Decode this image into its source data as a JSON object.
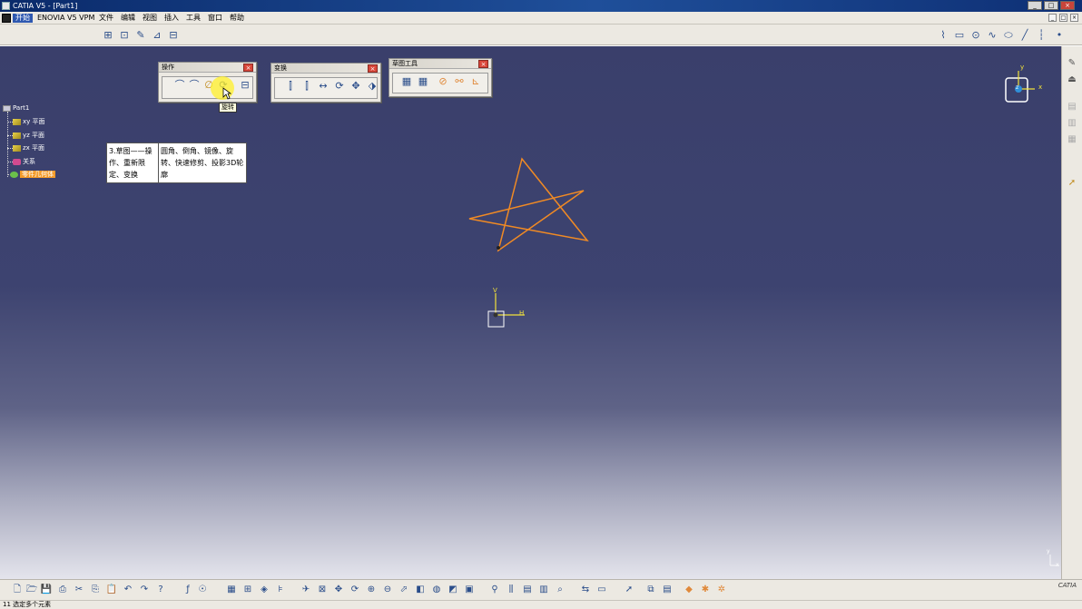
{
  "window": {
    "title": "CATIA V5 - [Part1]",
    "controls": [
      "_",
      "□",
      "×"
    ]
  },
  "menubar": {
    "items": [
      "开始",
      "ENOVIA V5 VPM",
      "文件",
      "编辑",
      "视图",
      "插入",
      "工具",
      "窗口",
      "帮助"
    ],
    "mdi_controls": [
      "_",
      "□",
      "×"
    ]
  },
  "palettes": {
    "operation": {
      "title": "操作",
      "close": "×"
    },
    "transform": {
      "title": "变换",
      "close": "×"
    },
    "sketch_tools": {
      "title": "草图工具",
      "close": "×"
    }
  },
  "tooltip": {
    "text": "旋转"
  },
  "tree": {
    "root": "Part1",
    "items": [
      {
        "label": "xy 平面",
        "icon": "plane-icon"
      },
      {
        "label": "yz 平面",
        "icon": "plane-icon"
      },
      {
        "label": "zx 平面",
        "icon": "plane-icon"
      },
      {
        "label": "关系",
        "icon": "relations-icon"
      },
      {
        "label": "零件几何体",
        "icon": "body-icon"
      }
    ]
  },
  "note": {
    "left": "3.草图——操作、重新限定、变换",
    "right": "圆角、倒角、镜像、旋转、快速修剪、投影3D轮廓"
  },
  "compass": {
    "x": "x",
    "y": "y",
    "z": "z"
  },
  "sketch_axes": {
    "v": "V",
    "h": "H"
  },
  "corner_axis": {
    "y": "y",
    "x": "x"
  },
  "bottom_brand": "CATIA",
  "status": {
    "text": "11 选定多个元素"
  },
  "colors": {
    "star_stroke": "#f08a24",
    "axis_yellow": "#f2e23a",
    "background_top": "#3a3f6b",
    "background_bottom": "#e4e4ec",
    "selection": "#f39b2a"
  }
}
